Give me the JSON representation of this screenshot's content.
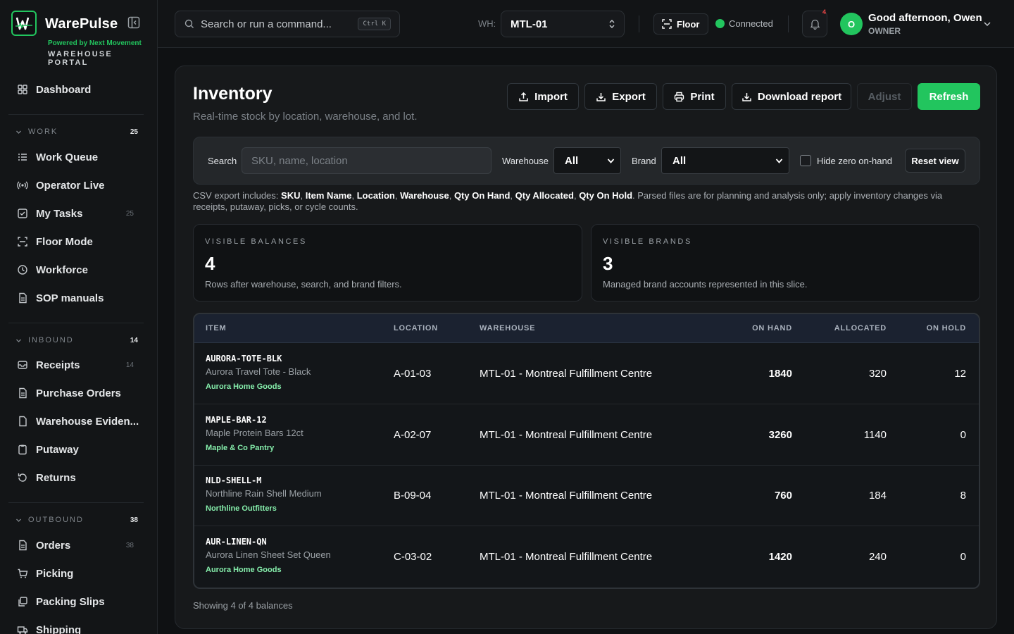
{
  "app": {
    "name": "WarePulse",
    "powered_by": "Powered by Next Movement",
    "portal": "WAREHOUSE PORTAL",
    "accent_color": "#22c55e"
  },
  "sidebar": {
    "dashboard": {
      "label": "Dashboard",
      "icon": "grid-icon"
    },
    "sections": [
      {
        "title": "WORK",
        "count": "25"
      },
      {
        "title": "INBOUND",
        "count": "14"
      },
      {
        "title": "OUTBOUND",
        "count": "38"
      }
    ],
    "work": [
      {
        "label": "Work Queue",
        "icon": "list-icon",
        "count": ""
      },
      {
        "label": "Operator Live",
        "icon": "radio-icon",
        "count": ""
      },
      {
        "label": "My Tasks",
        "icon": "checkbox-icon",
        "count": "25"
      },
      {
        "label": "Floor Mode",
        "icon": "scan-icon",
        "count": ""
      },
      {
        "label": "Workforce",
        "icon": "clock-icon",
        "count": ""
      },
      {
        "label": "SOP manuals",
        "icon": "document-icon",
        "count": ""
      }
    ],
    "inbound": [
      {
        "label": "Receipts",
        "icon": "inbox-icon",
        "count": "14"
      },
      {
        "label": "Purchase Orders",
        "icon": "document-icon",
        "count": ""
      },
      {
        "label": "Warehouse Eviden...",
        "icon": "file-icon",
        "count": ""
      },
      {
        "label": "Putaway",
        "icon": "clipboard-icon",
        "count": ""
      },
      {
        "label": "Returns",
        "icon": "return-icon",
        "count": ""
      }
    ],
    "outbound": [
      {
        "label": "Orders",
        "icon": "document-icon",
        "count": "38"
      },
      {
        "label": "Picking",
        "icon": "cart-icon",
        "count": ""
      },
      {
        "label": "Packing Slips",
        "icon": "copy-icon",
        "count": ""
      },
      {
        "label": "Shipping",
        "icon": "truck-icon",
        "count": ""
      }
    ]
  },
  "topbar": {
    "search_placeholder": "Search or run a command...",
    "shortcut": "Ctrl K",
    "wh_label": "WH:",
    "warehouse": "MTL-01",
    "floor_label": "Floor",
    "status": "Connected",
    "notification_count": "4",
    "avatar_initial": "O",
    "greeting": "Good afternoon, Owen",
    "role": "OWNER"
  },
  "page": {
    "title": "Inventory",
    "subtitle": "Real-time stock by location, warehouse, and lot.",
    "buttons": {
      "import": "Import",
      "export": "Export",
      "print": "Print",
      "download": "Download report",
      "adjust": "Adjust",
      "refresh": "Refresh"
    }
  },
  "filters": {
    "search_label": "Search",
    "search_placeholder": "SKU, name, location",
    "warehouse_label": "Warehouse",
    "warehouse_value": "All",
    "brand_label": "Brand",
    "brand_value": "All",
    "hide_zero_label": "Hide zero on-hand",
    "reset_label": "Reset view"
  },
  "csv_note": {
    "prefix": "CSV export includes:",
    "fields": [
      "SKU",
      "Item Name",
      "Location",
      "Warehouse",
      "Qty On Hand",
      "Qty Allocated",
      "Qty On Hold"
    ],
    "suffix": ". Parsed files are for planning and analysis only; apply inventory changes via receipts, putaway, picks, or cycle counts."
  },
  "stats": [
    {
      "label": "VISIBLE BALANCES",
      "value": "4",
      "desc": "Rows after warehouse, search, and brand filters."
    },
    {
      "label": "VISIBLE BRANDS",
      "value": "3",
      "desc": "Managed brand accounts represented in this slice."
    }
  ],
  "table": {
    "headers": {
      "item": "ITEM",
      "location": "LOCATION",
      "warehouse": "WAREHOUSE",
      "on_hand": "ON HAND",
      "allocated": "ALLOCATED",
      "on_hold": "ON HOLD"
    },
    "rows": [
      {
        "sku": "AURORA-TOTE-BLK",
        "name": "Aurora Travel Tote - Black",
        "brand": "Aurora Home Goods",
        "location": "A-01-03",
        "warehouse": "MTL-01 - Montreal Fulfillment Centre",
        "on_hand": "1840",
        "allocated": "320",
        "on_hold": "12"
      },
      {
        "sku": "MAPLE-BAR-12",
        "name": "Maple Protein Bars 12ct",
        "brand": "Maple & Co Pantry",
        "location": "A-02-07",
        "warehouse": "MTL-01 - Montreal Fulfillment Centre",
        "on_hand": "3260",
        "allocated": "1140",
        "on_hold": "0"
      },
      {
        "sku": "NLD-SHELL-M",
        "name": "Northline Rain Shell Medium",
        "brand": "Northline Outfitters",
        "location": "B-09-04",
        "warehouse": "MTL-01 - Montreal Fulfillment Centre",
        "on_hand": "760",
        "allocated": "184",
        "on_hold": "8"
      },
      {
        "sku": "AUR-LINEN-QN",
        "name": "Aurora Linen Sheet Set Queen",
        "brand": "Aurora Home Goods",
        "location": "C-03-02",
        "warehouse": "MTL-01 - Montreal Fulfillment Centre",
        "on_hand": "1420",
        "allocated": "240",
        "on_hold": "0"
      }
    ],
    "footer": "Showing 4 of 4 balances"
  }
}
